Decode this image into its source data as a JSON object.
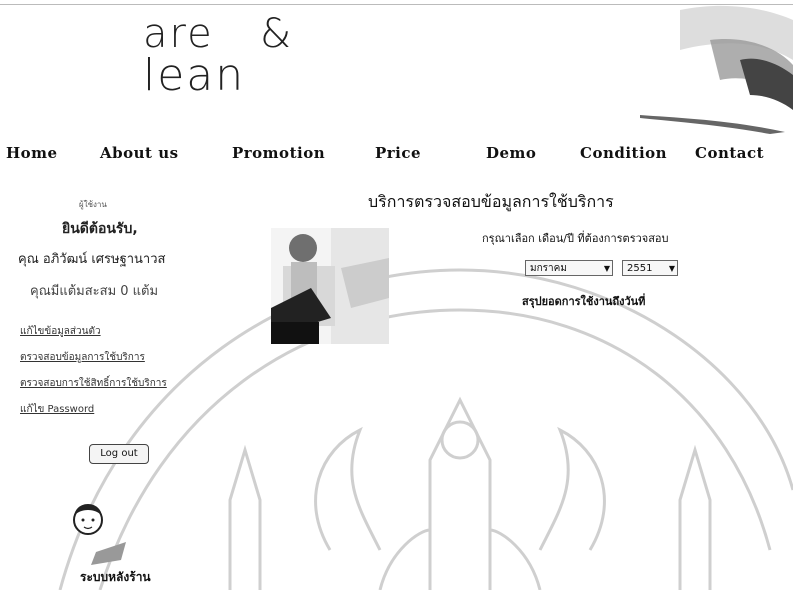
{
  "header": {
    "logo_line1": "are",
    "logo_amp": "&",
    "logo_line2": "lean"
  },
  "nav": {
    "items": [
      "Home",
      "About us",
      "Promotion",
      "Price",
      "Demo",
      "Condition",
      "Contact"
    ]
  },
  "sidebar": {
    "tiny_label": "ผู้ใช้งาน",
    "welcome": "ยินดีต้อนรับ,",
    "username": "คุณ อภิวัฒน์ เศรษฐานาวส",
    "points": "คุณมีแต้มสะสม 0 แต้ม",
    "links": [
      "แก้ไขข้อมูลส่วนตัว",
      "ตรวจสอบข้อมูลการใช้บริการ",
      "ตรวจสอบการใช้สิทธิ์การใช้บริการ",
      "แก้ไข Password"
    ],
    "logout_label": "Log out",
    "backoffice_label": "ระบบหลังร้าน"
  },
  "main": {
    "title": "บริการตรวจสอบข้อมูลการใช้บริการ",
    "instruction": "กรุณาเลือก เดือน/ปี ที่ต้องการตรวจสอบ",
    "month_value": "มกราคม",
    "year_value": "2551",
    "summary_link": "สรุปยอดการใช้งานถึงวันที่"
  }
}
